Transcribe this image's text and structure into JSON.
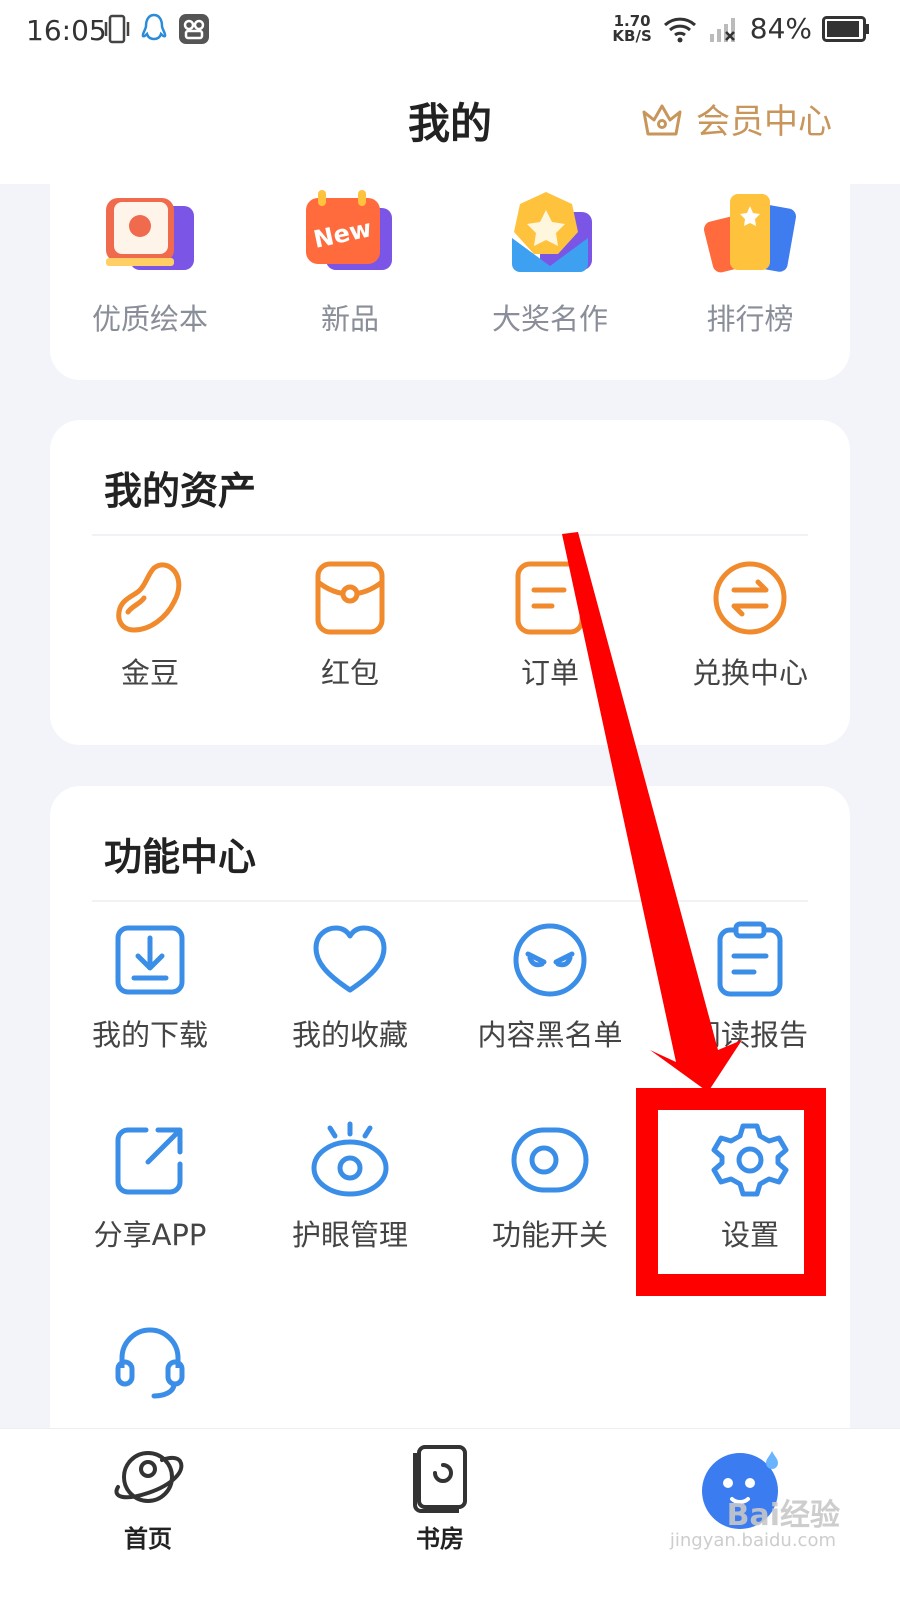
{
  "status_bar": {
    "time": "16:05",
    "net_speed_value": "1.70",
    "net_speed_unit": "KB/S",
    "battery": "84%"
  },
  "header": {
    "title": "我的",
    "vip_label": "会员中心"
  },
  "categories": [
    {
      "label": "优质绘本",
      "icon": "picture-book-icon"
    },
    {
      "label": "新品",
      "icon": "new-calendar-icon"
    },
    {
      "label": "大奖名作",
      "icon": "award-star-icon"
    },
    {
      "label": "排行榜",
      "icon": "ranking-cards-icon"
    }
  ],
  "new_badge_text": "New",
  "assets": {
    "title": "我的资产",
    "items": [
      {
        "label": "金豆",
        "icon": "bean-icon"
      },
      {
        "label": "红包",
        "icon": "red-packet-icon"
      },
      {
        "label": "订单",
        "icon": "order-icon"
      },
      {
        "label": "兑换中心",
        "icon": "exchange-icon"
      }
    ]
  },
  "functions": {
    "title": "功能中心",
    "row1": [
      {
        "label": "我的下载",
        "icon": "download-icon"
      },
      {
        "label": "我的收藏",
        "icon": "heart-icon"
      },
      {
        "label": "内容黑名单",
        "icon": "blacklist-face-icon"
      },
      {
        "label": "阅读报告",
        "icon": "clipboard-report-icon"
      }
    ],
    "row2": [
      {
        "label": "分享APP",
        "icon": "share-icon"
      },
      {
        "label": "护眼管理",
        "icon": "eye-care-icon"
      },
      {
        "label": "功能开关",
        "icon": "toggle-icon"
      },
      {
        "label": "设置",
        "icon": "gear-icon"
      }
    ],
    "row3": [
      {
        "label": "",
        "icon": "headset-icon"
      }
    ]
  },
  "tabbar": {
    "home": "首页",
    "bookshelf": "书房"
  },
  "watermark": {
    "brand": "Bai经验",
    "url": "jingyan.baidu.com"
  },
  "colors": {
    "accent_orange": "#f08a2c",
    "accent_blue": "#3b8ee8",
    "vip_gold": "#c8955a",
    "highlight_red": "#ff0000"
  }
}
